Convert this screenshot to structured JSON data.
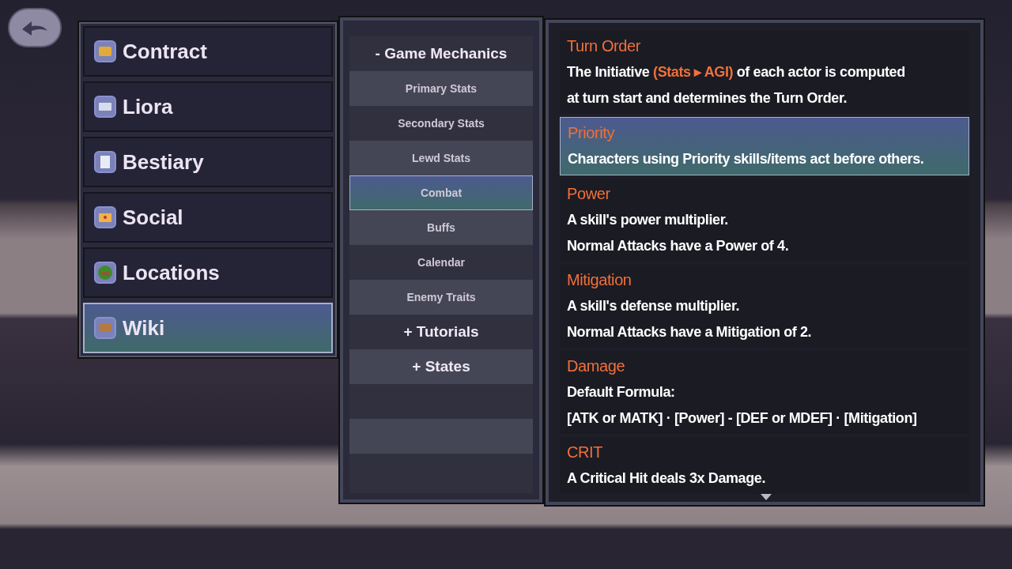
{
  "menu": [
    {
      "label": "Contract",
      "selected": false
    },
    {
      "label": "Liora",
      "selected": false
    },
    {
      "label": "Bestiary",
      "selected": false
    },
    {
      "label": "Social",
      "selected": false
    },
    {
      "label": "Locations",
      "selected": false
    },
    {
      "label": "Wiki",
      "selected": true
    }
  ],
  "topics": [
    {
      "label": "- Game Mechanics",
      "kind": "category",
      "selected": false
    },
    {
      "label": "Primary Stats",
      "kind": "item",
      "selected": false
    },
    {
      "label": "Secondary Stats",
      "kind": "item",
      "selected": false
    },
    {
      "label": "Lewd Stats",
      "kind": "item",
      "selected": false
    },
    {
      "label": "Combat",
      "kind": "item",
      "selected": true
    },
    {
      "label": "Buffs",
      "kind": "item",
      "selected": false
    },
    {
      "label": "Calendar",
      "kind": "item",
      "selected": false
    },
    {
      "label": "Enemy Traits",
      "kind": "item",
      "selected": false
    },
    {
      "label": "+ Tutorials",
      "kind": "category",
      "selected": false
    },
    {
      "label": "+ States",
      "kind": "category",
      "selected": false
    }
  ],
  "entries": [
    {
      "title": "Turn Order",
      "selected": false,
      "lines": [
        [
          {
            "text": "The Initiative ",
            "accent": false
          },
          {
            "text": "(Stats ▸ AGI)",
            "accent": true
          },
          {
            "text": " of each actor is computed",
            "accent": false
          }
        ],
        "at turn start and determines the Turn Order."
      ]
    },
    {
      "title": "Priority",
      "selected": true,
      "lines": [
        "Characters using Priority skills/items act before others."
      ]
    },
    {
      "title": "Power",
      "selected": false,
      "lines": [
        "A skill's power multiplier.",
        "Normal Attacks have a Power of 4."
      ]
    },
    {
      "title": "Mitigation",
      "selected": false,
      "lines": [
        "A skill's defense multiplier.",
        "Normal Attacks have a Mitigation of 2."
      ]
    },
    {
      "title": "Damage",
      "selected": false,
      "lines": [
        "Default Formula:",
        "[ATK or MATK] · [Power] - [DEF or MDEF] · [Mitigation]"
      ]
    },
    {
      "title": "CRIT",
      "selected": false,
      "lines": [
        "A Critical Hit deals 3x Damage."
      ]
    }
  ]
}
